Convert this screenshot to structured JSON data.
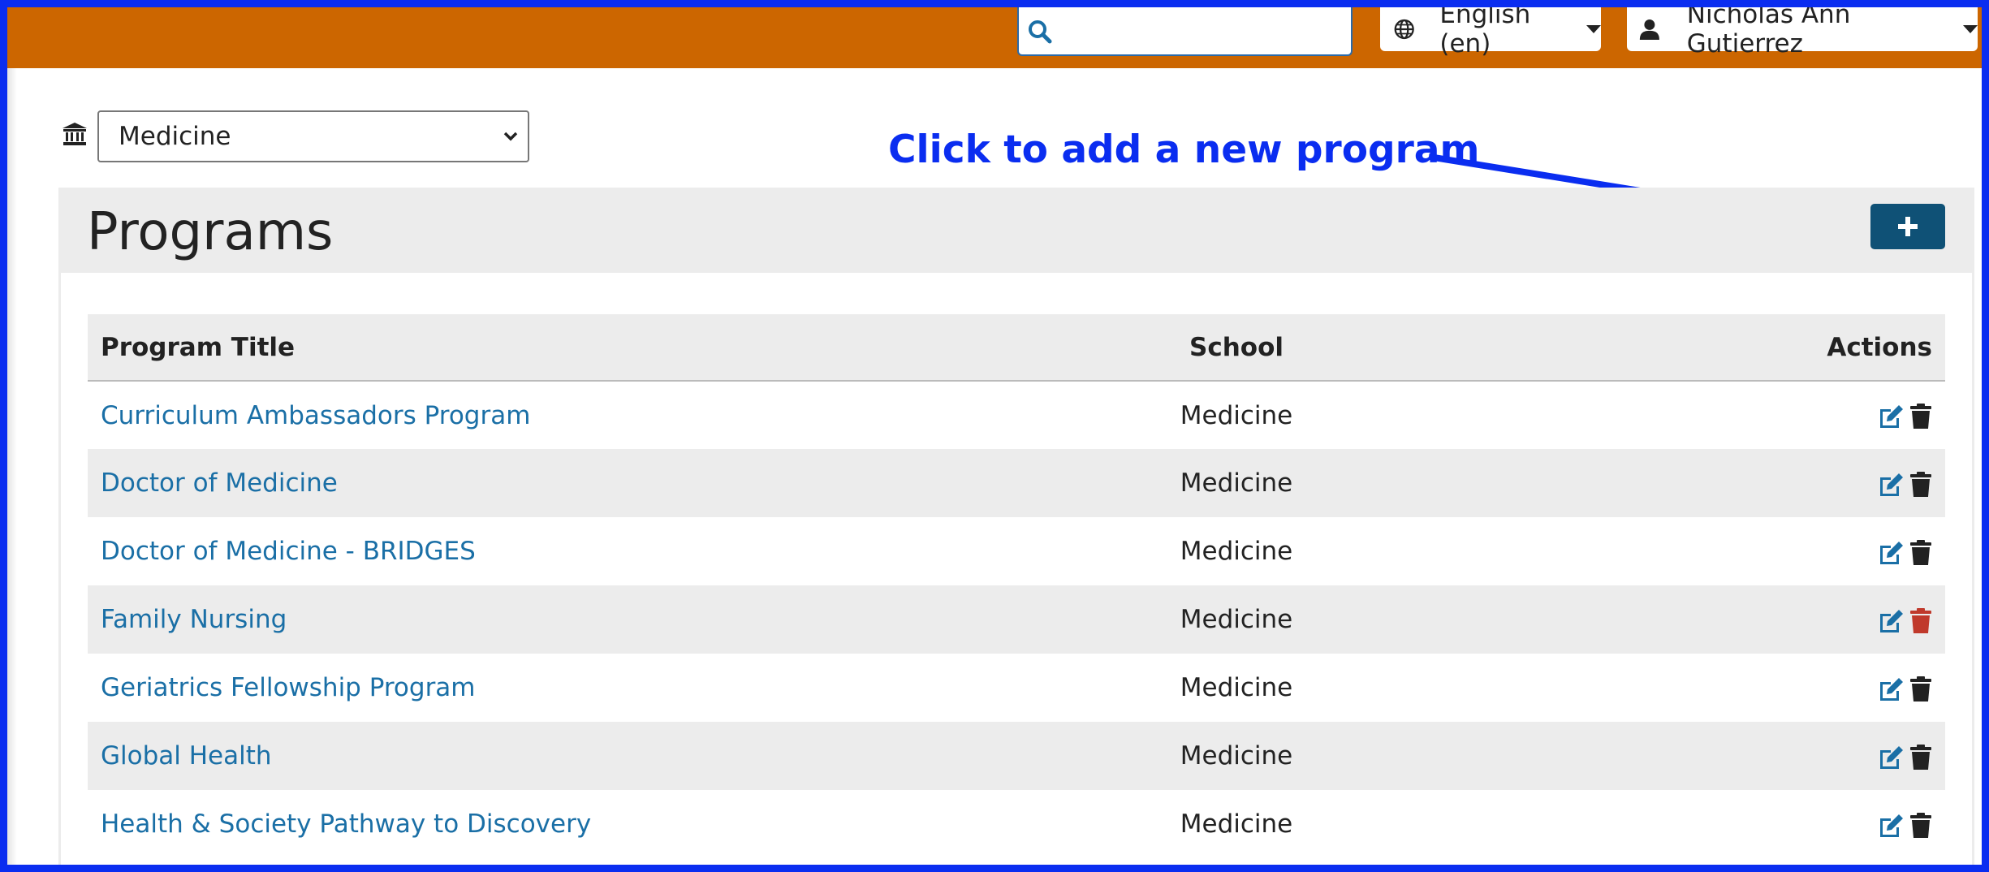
{
  "header": {
    "search": {
      "placeholder": ""
    },
    "language": {
      "label": "English (en)"
    },
    "user": {
      "name": "Nicholas Ann Gutierrez"
    }
  },
  "school_selector": {
    "selected": "Medicine"
  },
  "annotation": {
    "text": "Click to add a new program"
  },
  "page": {
    "title": "Programs"
  },
  "table": {
    "headers": {
      "title": "Program Title",
      "school": "School",
      "actions": "Actions"
    },
    "rows": [
      {
        "title": "Curriculum Ambassadors Program",
        "school": "Medicine",
        "delete_color": "#222222"
      },
      {
        "title": "Doctor of Medicine",
        "school": "Medicine",
        "delete_color": "#222222"
      },
      {
        "title": "Doctor of Medicine - BRIDGES",
        "school": "Medicine",
        "delete_color": "#222222"
      },
      {
        "title": "Family Nursing",
        "school": "Medicine",
        "delete_color": "#c0392b"
      },
      {
        "title": "Geriatrics Fellowship Program",
        "school": "Medicine",
        "delete_color": "#222222"
      },
      {
        "title": "Global Health",
        "school": "Medicine",
        "delete_color": "#222222"
      },
      {
        "title": "Health & Society Pathway to Discovery",
        "school": "Medicine",
        "delete_color": "#222222"
      }
    ]
  },
  "colors": {
    "topbar": "#cc6600",
    "annotation": "#0a2df0",
    "add_button": "#0f5176",
    "link": "#1a6fa6",
    "edit_icon": "#1a6fa6"
  },
  "icons": {
    "search": "search-icon",
    "globe": "globe-icon",
    "user": "user-icon",
    "school": "institution-icon",
    "add": "plus-icon",
    "edit": "edit-icon",
    "delete": "trash-icon"
  }
}
